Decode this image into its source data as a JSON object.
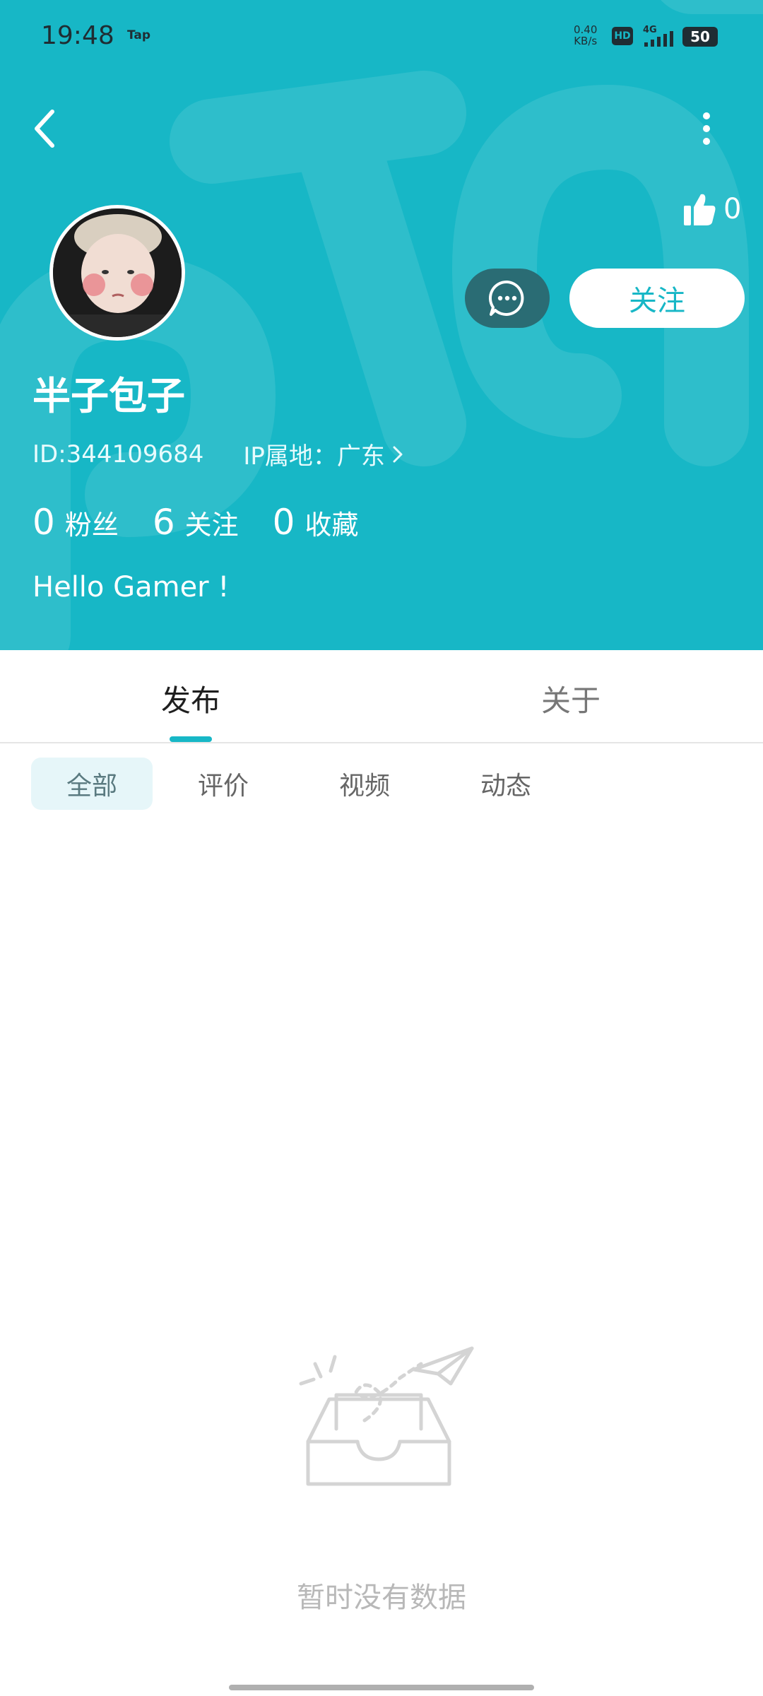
{
  "status_bar": {
    "time": "19:48",
    "app_badge": "Tap",
    "net_speed_value": "0.40",
    "net_speed_unit": "KB/s",
    "hd": "HD",
    "network": "4G",
    "battery": "50"
  },
  "profile": {
    "likes": "0",
    "follow_label": "关注",
    "username": "半子包子",
    "id": "ID:344109684",
    "ip": "IP属地：广东",
    "bio": "Hello Gamer !",
    "stats": [
      {
        "num": "0",
        "label": "粉丝"
      },
      {
        "num": "6",
        "label": "关注"
      },
      {
        "num": "0",
        "label": "收藏"
      }
    ]
  },
  "tabs": [
    "发布",
    "关于"
  ],
  "chips": [
    "全部",
    "评价",
    "视频",
    "动态"
  ],
  "empty": {
    "text": "暂时没有数据"
  },
  "colors": {
    "accent": "#17b7c6",
    "message_button": "#2a6c74"
  }
}
